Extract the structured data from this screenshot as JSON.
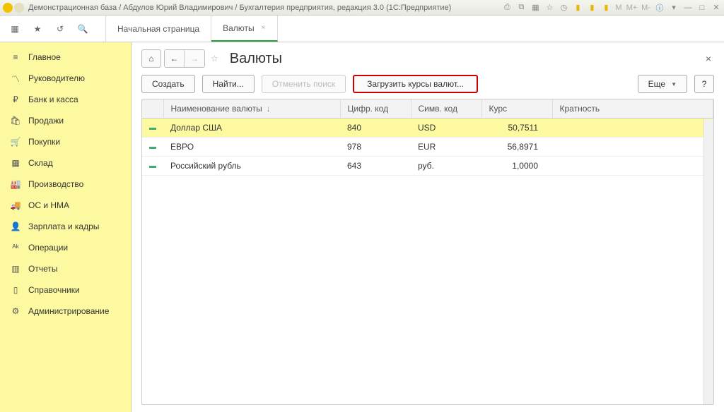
{
  "titlebar": {
    "text": "Демонстрационная база / Абдулов Юрий Владимирович / Бухгалтерия предприятия, редакция 3.0  (1С:Предприятие)"
  },
  "tabs": {
    "home": "Начальная страница",
    "active": "Валюты"
  },
  "sidebar": {
    "items": [
      {
        "icon": "home",
        "label": "Главное"
      },
      {
        "icon": "chart",
        "label": "Руководителю"
      },
      {
        "icon": "ruble",
        "label": "Банк и касса"
      },
      {
        "icon": "bag",
        "label": "Продажи"
      },
      {
        "icon": "cart",
        "label": "Покупки"
      },
      {
        "icon": "grid",
        "label": "Склад"
      },
      {
        "icon": "factory",
        "label": "Производство"
      },
      {
        "icon": "truck",
        "label": "ОС и НМА"
      },
      {
        "icon": "person",
        "label": "Зарплата и кадры"
      },
      {
        "icon": "ops",
        "label": "Операции"
      },
      {
        "icon": "bars",
        "label": "Отчеты"
      },
      {
        "icon": "book",
        "label": "Справочники"
      },
      {
        "icon": "gear",
        "label": "Администрирование"
      }
    ]
  },
  "page": {
    "title": "Валюты"
  },
  "toolbar": {
    "create": "Создать",
    "find": "Найти...",
    "cancel": "Отменить поиск",
    "load": "Загрузить курсы валют...",
    "more": "Еще",
    "help": "?"
  },
  "table": {
    "cols": [
      "",
      "Наименование валюты",
      "Цифр. код",
      "Симв. код",
      "Курс",
      "Кратность"
    ],
    "rows": [
      {
        "name": "Доллар США",
        "num": "840",
        "sym": "USD",
        "rate": "50,7511",
        "mult": "",
        "sel": true
      },
      {
        "name": "ЕВРО",
        "num": "978",
        "sym": "EUR",
        "rate": "56,8971",
        "mult": ""
      },
      {
        "name": "Российский рубль",
        "num": "643",
        "sym": "руб.",
        "rate": "1,0000",
        "mult": ""
      }
    ]
  }
}
